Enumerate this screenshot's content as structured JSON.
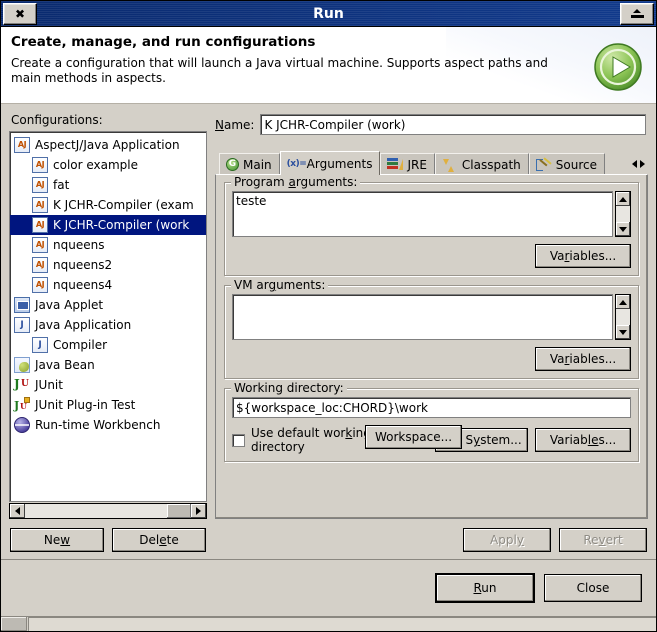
{
  "window": {
    "title": "Run",
    "close_icon": "close-x-icon",
    "maximize_icon": "maximize-icon"
  },
  "header": {
    "title": "Create, manage, and run configurations",
    "description": "Create a configuration that will launch a Java virtual machine. Supports aspect paths and main methods in aspects.",
    "icon": "green-run-play-icon",
    "icon_color": "#6cb33f"
  },
  "left": {
    "configurations_label": "Configurations:",
    "tree": [
      {
        "label": "AspectJ/Java Application",
        "icon": "aspectj-app-icon",
        "indent": 0,
        "twisty": "open",
        "selected": false
      },
      {
        "label": "color example",
        "icon": "aspectj-app-icon",
        "indent": 1,
        "twisty": "none",
        "selected": false
      },
      {
        "label": "fat",
        "icon": "aspectj-app-icon",
        "indent": 1,
        "twisty": "none",
        "selected": false
      },
      {
        "label": "K JCHR-Compiler (exam",
        "icon": "aspectj-app-icon",
        "indent": 1,
        "twisty": "none",
        "selected": false
      },
      {
        "label": "K JCHR-Compiler (work",
        "icon": "aspectj-app-icon",
        "indent": 1,
        "twisty": "none",
        "selected": true
      },
      {
        "label": "nqueens",
        "icon": "aspectj-app-icon",
        "indent": 1,
        "twisty": "none",
        "selected": false
      },
      {
        "label": "nqueens2",
        "icon": "aspectj-app-icon",
        "indent": 1,
        "twisty": "none",
        "selected": false
      },
      {
        "label": "nqueens4",
        "icon": "aspectj-app-icon",
        "indent": 1,
        "twisty": "none",
        "selected": false
      },
      {
        "label": "Java Applet",
        "icon": "java-applet-icon",
        "indent": 0,
        "twisty": "none",
        "selected": false
      },
      {
        "label": "Java Application",
        "icon": "java-app-icon",
        "indent": 0,
        "twisty": "open",
        "selected": false
      },
      {
        "label": "Compiler",
        "icon": "java-app-icon",
        "indent": 1,
        "twisty": "none",
        "selected": false
      },
      {
        "label": "Java Bean",
        "icon": "java-bean-icon",
        "indent": 0,
        "twisty": "none",
        "selected": false
      },
      {
        "label": "JUnit",
        "icon": "junit-icon",
        "indent": 0,
        "twisty": "none",
        "selected": false
      },
      {
        "label": "JUnit Plug-in Test",
        "icon": "junit-plugin-icon",
        "indent": 0,
        "twisty": "none",
        "selected": false
      },
      {
        "label": "Run-time Workbench",
        "icon": "runtime-workbench-icon",
        "indent": 0,
        "twisty": "none",
        "selected": false
      }
    ],
    "new_button": "New",
    "delete_button": "Delete",
    "selection_color": "#00157f"
  },
  "right": {
    "name_label": "Name:",
    "name_value": "K JCHR-Compiler (work)",
    "tabs": [
      {
        "label": "Main",
        "icon": "main-green-circle-icon",
        "active": false
      },
      {
        "label": "Arguments",
        "icon": "arguments-variable-icon",
        "active": true
      },
      {
        "label": "JRE",
        "icon": "jre-books-icon",
        "active": false
      },
      {
        "label": "Classpath",
        "icon": "classpath-arrows-icon",
        "active": false
      },
      {
        "label": "Source",
        "icon": "source-edit-icon",
        "active": false
      }
    ],
    "tab_nav_left_icon": "tab-scroll-left-icon",
    "tab_nav_right_icon": "tab-scroll-right-icon",
    "program_arguments": {
      "label": "Program arguments:",
      "value": "teste",
      "variables_button": "Variables..."
    },
    "vm_arguments": {
      "label": "VM arguments:",
      "value": "",
      "variables_button": "Variables..."
    },
    "working_directory": {
      "label": "Working directory:",
      "value": "${workspace_loc:CHORD}\\work",
      "use_default_label": "Use default working directory",
      "use_default_checked": false,
      "workspace_button": "Workspace...",
      "file_system_button": "File System...",
      "variables_button": "Variables..."
    },
    "apply_button": "Apply",
    "revert_button": "Revert",
    "apply_enabled": false,
    "revert_enabled": false
  },
  "footer": {
    "run_button": "Run",
    "close_button": "Close"
  }
}
